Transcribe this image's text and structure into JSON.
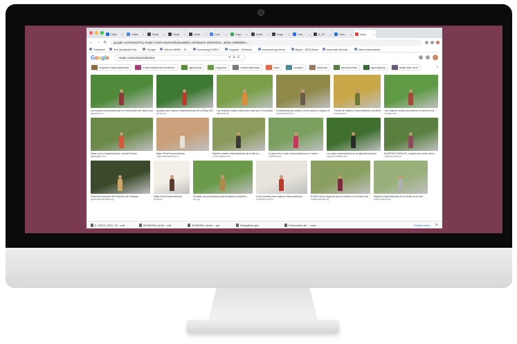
{
  "browser": {
    "tabs": [
      {
        "label": "Hotel",
        "color": "#1a73e8"
      },
      {
        "label": "Calen",
        "color": "#4285f4"
      },
      {
        "label": "Gesti",
        "color": "#3c4043"
      },
      {
        "label": "Gesti",
        "color": "#3c4043"
      },
      {
        "label": "Gesti",
        "color": "#3c4043"
      },
      {
        "label": "Com",
        "color": "#4285f4"
      },
      {
        "label": "Copi",
        "color": "#34a853"
      },
      {
        "label": "Gesti",
        "color": "#3c4043"
      },
      {
        "label": "Imge",
        "color": "#3c4043"
      },
      {
        "label": "Trat",
        "color": "#1a73e8"
      },
      {
        "label": "8_20",
        "color": "#3c4043"
      },
      {
        "label": "Serv",
        "color": "#1a73e8"
      },
      {
        "label": "muje",
        "color": "#ea4335",
        "active": true
      }
    ],
    "url": "google.com/search?q=mujer+rural+emprendedora&tbm=isch&ved=2ahUKEwi...&biw=1680&bih=...",
    "bookmarks": [
      "Traductor",
      "The Qualitative De...",
      "Google",
      "What is BRDI - Th...",
      "Accessing EURO...",
      "Linguee - Dictiona...",
      "economic governa...",
      "Byarn - SEA Diario",
      "www.ase.mit.edu...",
      "Otros marcadores"
    ]
  },
  "google": {
    "logo": "Google",
    "query": "mujer rural emprendedora",
    "chips": [
      {
        "label": "mujeres emprendedoras",
        "color": "#8a6a45"
      },
      {
        "label": "emprendimiento femenino",
        "color": "#a43d7a"
      },
      {
        "label": "agricultura",
        "color": "#5a8a3a"
      },
      {
        "label": "negocios",
        "color": "#6a9a4a"
      },
      {
        "label": "emprendedoras",
        "color": "#7a7a7a"
      },
      {
        "label": "taller",
        "color": "#e06a4a"
      },
      {
        "label": "creativo",
        "color": "#4a8a9a"
      },
      {
        "label": "historias",
        "color": "#9a7a5a"
      },
      {
        "label": "asociaciones",
        "color": "#5a7a4a"
      },
      {
        "label": "agricultoras",
        "color": "#3a6a3a"
      },
      {
        "label": "mitad arte rural",
        "color": "#6a5a7a"
      }
    ],
    "rows": [
      [
        {
          "caption": "Las mujeres emprendedoras en el desarrollo del medio rural",
          "source": "agroinfo.com",
          "bg": "#4e8a3a",
          "fig": "#8b3a3a",
          "w": 90
        },
        {
          "caption": "Ayudas para mujeres emprendedoras de La Rioja 2021",
          "source": "larioja.org",
          "bg": "#3f7a35",
          "fig": "#c0392b",
          "w": 82
        },
        {
          "caption": "Las mujeres rurales emprenden más que en la ciudad",
          "source": "agronews.es",
          "bg": "#7aa04a",
          "fig": "#d98c3a",
          "w": 82
        },
        {
          "caption": "Emprendedoras rurales y cómo crear un negocio en...",
          "source": "blog.emprende.es",
          "bg": "#8f8a4a",
          "fig": "#6a5a4a",
          "w": 78
        },
        {
          "caption": "Premio de Mujeres Emprendedoras del Medio Rural",
          "source": "mapa.gob.es",
          "bg": "#c9a84a",
          "fig": "#6a7a3a",
          "w": 68
        },
        {
          "caption": "Las mujeres rurales demuestran su fuerza en la...",
          "source": "efeagro.com",
          "bg": "#5f9a45",
          "fig": "#a04a3a",
          "w": 78
        }
      ],
      [
        {
          "caption": "Mujer rural y emprendedora, un perfil al alza",
          "source": "agrodigital.com",
          "bg": "#6b8a4a",
          "fig": "#d05a3a",
          "w": 90
        },
        {
          "caption": "Mujer Rural Emprendedora",
          "source": "mujerruralemprende.es",
          "bg": "#c9a07a",
          "fig": "#e8e0d0",
          "w": 76
        },
        {
          "caption": "Mujeres rurales emprendedoras de la tierra y...",
          "source": "comunidadrural.es",
          "bg": "#8a9a5a",
          "fig": "#3a3a3a",
          "w": 76
        },
        {
          "caption": "El papel de la mujer emprendedora en el medio...",
          "source": "ruralactiva.es",
          "bg": "#7aa060",
          "fig": "#c03a5a",
          "w": 80
        },
        {
          "caption": "La mujer emprendedora en la agricultura actual",
          "source": "agroinformacion.com",
          "bg": "#3f7030",
          "fig": "#2a2a2a",
          "w": 78
        },
        {
          "caption": "MUJERES RURALES, mujeres que crean futuro",
          "source": "mujeresrurales.es",
          "bg": "#5a8040",
          "fig": "#8a4a5a",
          "w": 78
        }
      ],
      [
        {
          "caption": "Portal de formación del Gobierno de Canarias",
          "source": "gobiernodecanarias.org",
          "bg": "#3a4a2a",
          "fig": "#c9a86a",
          "w": 86
        },
        {
          "caption": "Mujer Rural Emprendedora",
          "source": "Bimbués",
          "bg": "#f4efe6",
          "fig": "#5a3a2a",
          "w": 52
        },
        {
          "caption": "Semillas: las promotoras para formación a mujeres...",
          "source": "fao.org",
          "bg": "#6a9a4a",
          "fig": "#b08a4a",
          "w": 86
        },
        {
          "caption": "Curso gratuito para mujeres emprendedoras",
          "source": "formacionrural.es",
          "bg": "#e8e4dc",
          "fig": "#c0392b",
          "w": 74
        },
        {
          "caption": "El 80% de los negocios que se inician en el medio rural",
          "source": "ruralemprende.org",
          "bg": "#8aa060",
          "fig": "#7a2a3a",
          "w": 86
        },
        {
          "caption": "Mujeres emprendedoras en el medio rural rural",
          "source": "emprenderural.es",
          "bg": "#9ab07a",
          "fig": "#b0b0b0",
          "w": 78
        }
      ]
    ]
  },
  "downloads": {
    "items": [
      "II_CIIDS_2021_Tri....pdf",
      "20166309_mh04....pdf",
      "20184369_inncio....pdf",
      "infografias.pptx",
      "Documento de ....docx"
    ],
    "show_all": "Mostrar todo"
  }
}
